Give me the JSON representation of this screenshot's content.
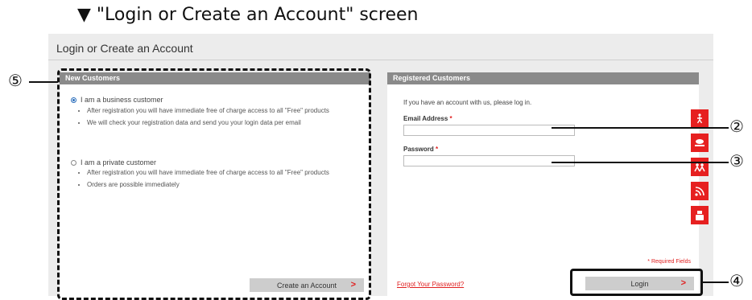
{
  "heading": "▼ \"Login or Create an Account\" screen",
  "screen_title": "Login or Create an Account",
  "new_customers": {
    "header": "New Customers",
    "option_business": "I am a business customer",
    "business_bullets": [
      "After registration you will have immediate free of charge access to all \"Free\" products",
      "We will check your registration data and send you your login data per email"
    ],
    "option_private": "I am a private customer",
    "private_bullets": [
      "After registration you will have immediate free of charge access to all \"Free\" products",
      "Orders are possible immediately"
    ],
    "create_button": "Create an Account",
    "arrow": ">"
  },
  "registered": {
    "header": "Registered Customers",
    "intro": "If you have an account with us, please log in.",
    "email_label": "Email Address",
    "password_label": "Password",
    "required_star": "*",
    "required_note": "* Required Fields",
    "forgot_link": "Forgot Your Password?",
    "login_button": "Login",
    "arrow": ">"
  },
  "callouts": {
    "c2": "②",
    "c3": "③",
    "c4": "④",
    "c5": "⑤"
  },
  "social_icons": [
    "person-icon",
    "monitor-icon",
    "people-icon",
    "rss-icon",
    "youtube-icon"
  ],
  "colors": {
    "accent_red": "#e02020",
    "panel_header": "#8a8a8a"
  }
}
